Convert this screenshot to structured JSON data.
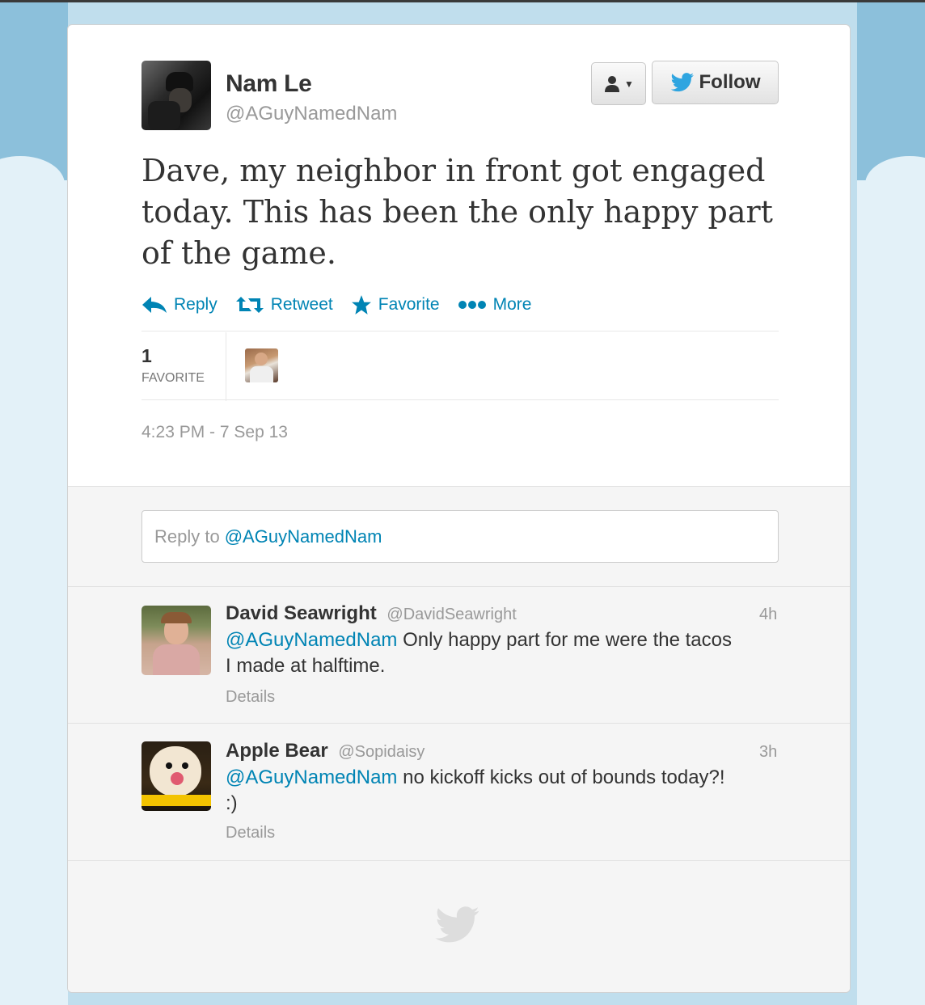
{
  "tweet": {
    "name": "Nam Le",
    "handle": "@AGuyNamedNam",
    "text": "Dave, my neighbor in front got engaged today. This has been the only happy part of the game.",
    "follow_label": "Follow",
    "actions": {
      "reply": "Reply",
      "retweet": "Retweet",
      "favorite": "Favorite",
      "more": "More"
    },
    "favorites_count": "1",
    "favorites_label": "FAVORITE",
    "timestamp": "4:23 PM - 7 Sep 13"
  },
  "reply_box": {
    "prefix": "Reply to",
    "mention": "@AGuyNamedNam"
  },
  "replies": [
    {
      "name": "David Seawright",
      "handle": "@DavidSeawright",
      "time": "4h",
      "mention": "@AGuyNamedNam",
      "line1": " Only happy part for me were the tacos",
      "line2": "I made at halftime.",
      "details": "Details"
    },
    {
      "name": "Apple Bear",
      "handle": "@Sopidaisy",
      "time": "3h",
      "mention": "@AGuyNamedNam",
      "line1": " no kickoff kicks out of bounds today?!",
      "line2": ":)",
      "details": "Details"
    }
  ],
  "colors": {
    "link": "#0084b4",
    "text": "#333333",
    "muted": "#999999",
    "background_sky": "#c0deed"
  },
  "icons": {
    "follow": "twitter-bird-icon",
    "user_menu": "user-dropdown-icon",
    "reply": "reply-arrow-icon",
    "retweet": "retweet-icon",
    "favorite": "star-icon",
    "more": "more-dots-icon",
    "footer": "twitter-bird-icon"
  }
}
